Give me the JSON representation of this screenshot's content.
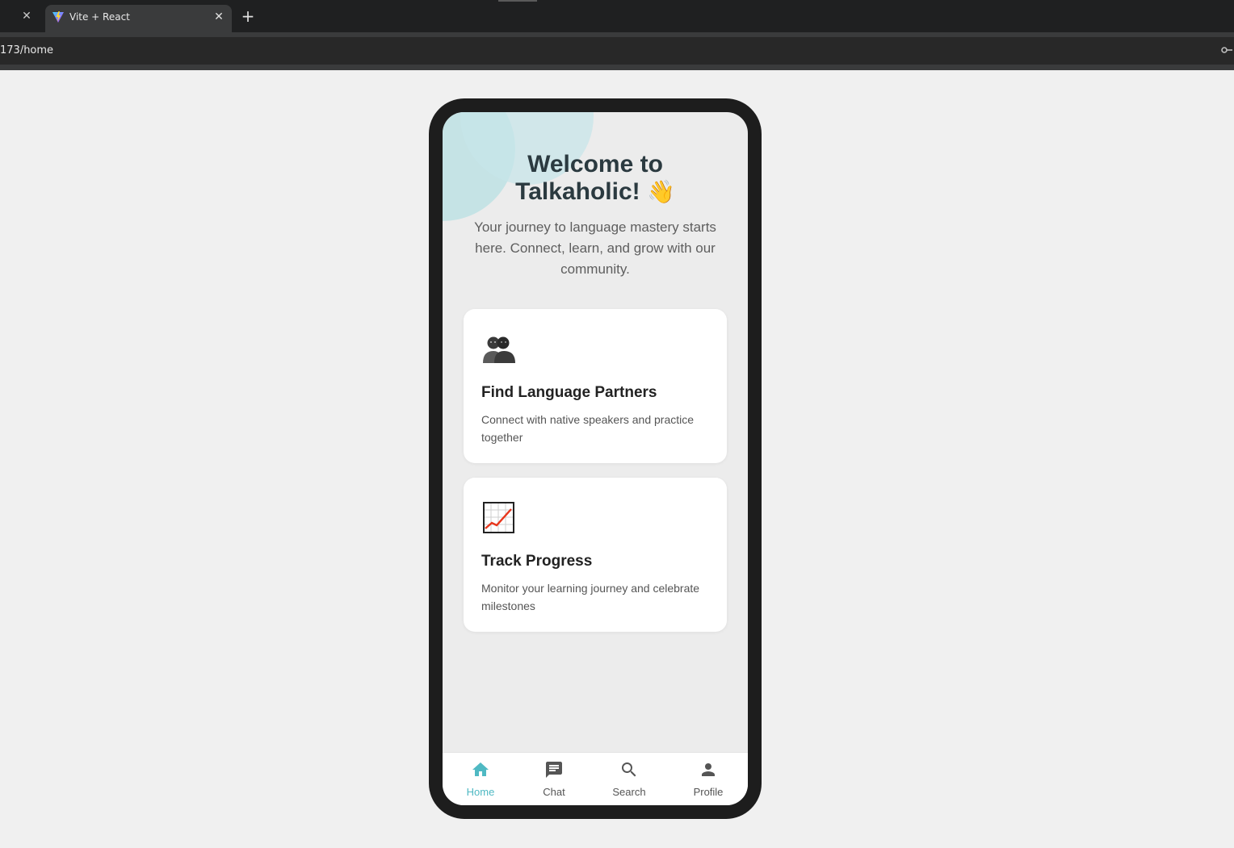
{
  "browser": {
    "tab_title": "Vite + React",
    "url": "173/home",
    "close_glyph": "✕",
    "new_tab_glyph": "+"
  },
  "app": {
    "welcome_line1": "Welcome to",
    "welcome_line2": "Talkaholic!",
    "wave_emoji": "👋",
    "subtitle": "Your journey to language mastery starts here. Connect, learn, and grow with our community.",
    "cards": [
      {
        "icon": "people-icon",
        "title": "Find Language Partners",
        "description": "Connect with native speakers and practice together"
      },
      {
        "icon": "chart-increasing-icon",
        "title": "Track Progress",
        "description": "Monitor your learning journey and celebrate milestones"
      }
    ],
    "nav": [
      {
        "label": "Home",
        "icon": "home-icon",
        "active": true
      },
      {
        "label": "Chat",
        "icon": "chat-icon",
        "active": false
      },
      {
        "label": "Search",
        "icon": "search-icon",
        "active": false
      },
      {
        "label": "Profile",
        "icon": "person-icon",
        "active": false
      }
    ]
  },
  "colors": {
    "accent": "#4fb9c3",
    "phone_frame": "#1d1d1d",
    "screen_bg": "#ececec"
  }
}
